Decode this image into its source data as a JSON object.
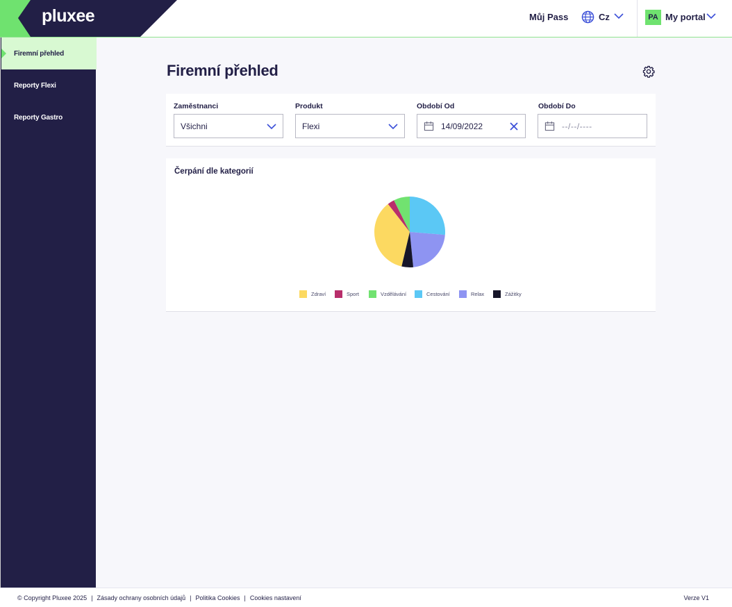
{
  "header": {
    "logo": "pluxee",
    "my_pass": "Můj Pass",
    "language": "Cz",
    "avatar_initials": "PA",
    "portal": "My portal"
  },
  "sidebar": {
    "items": [
      {
        "label": "Firemní přehled",
        "active": true
      },
      {
        "label": "Reporty Flexi",
        "active": false
      },
      {
        "label": "Reporty Gastro",
        "active": false
      }
    ]
  },
  "main": {
    "title": "Firemní přehled",
    "filters": {
      "employees": {
        "label": "Zaměstnanci",
        "value": "Všichni"
      },
      "product": {
        "label": "Produkt",
        "value": "Flexi"
      },
      "date_from": {
        "label": "Období Od",
        "value": "14/09/2022"
      },
      "date_to": {
        "label": "Období Do",
        "placeholder": "--/--/----"
      }
    },
    "chart_title": "Čerpání dle kategorií"
  },
  "chart_data": {
    "type": "pie",
    "title": "Čerpání dle kategorií",
    "legend_position": "bottom",
    "slices": [
      {
        "label": "Zdraví",
        "value": 34,
        "color": "#fcd961"
      },
      {
        "label": "Sport",
        "value": 3,
        "color": "#b82e6b"
      },
      {
        "label": "Vzdělávání",
        "value": 7,
        "color": "#71e270"
      },
      {
        "label": "Cestování",
        "value": 25,
        "color": "#5bc8f5"
      },
      {
        "label": "Relax",
        "value": 21,
        "color": "#8e94f2"
      },
      {
        "label": "Zážitky",
        "value": 5,
        "color": "#171629"
      }
    ]
  },
  "footer": {
    "copyright": "© Copyright Pluxee 2025",
    "privacy": "Zásady ochrany osobních údajů",
    "cookies_policy": "Politika Cookies",
    "cookies_settings": "Cookies nastavení",
    "version": "Verze V1"
  },
  "colors": {
    "navy": "#221f46",
    "green": "#6fe26f",
    "active_bg": "#d8f9d2",
    "accent_blue": "#3b4fd8"
  }
}
